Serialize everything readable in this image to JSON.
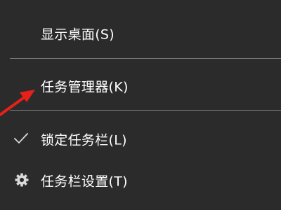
{
  "context_menu": {
    "items": [
      {
        "label": "显示桌面(S)"
      },
      {
        "label": "任务管理器(K)"
      },
      {
        "label": "锁定任务栏(L)",
        "checked": true,
        "icon": "check-icon"
      },
      {
        "label": "任务栏设置(T)",
        "icon": "gear-icon"
      }
    ]
  },
  "colors": {
    "menu_background": "#2b2b2b",
    "text": "#ffffff",
    "separator": "#7a7a7a",
    "icon": "#d9d9d9",
    "annotation_arrow": "#e8201a"
  }
}
